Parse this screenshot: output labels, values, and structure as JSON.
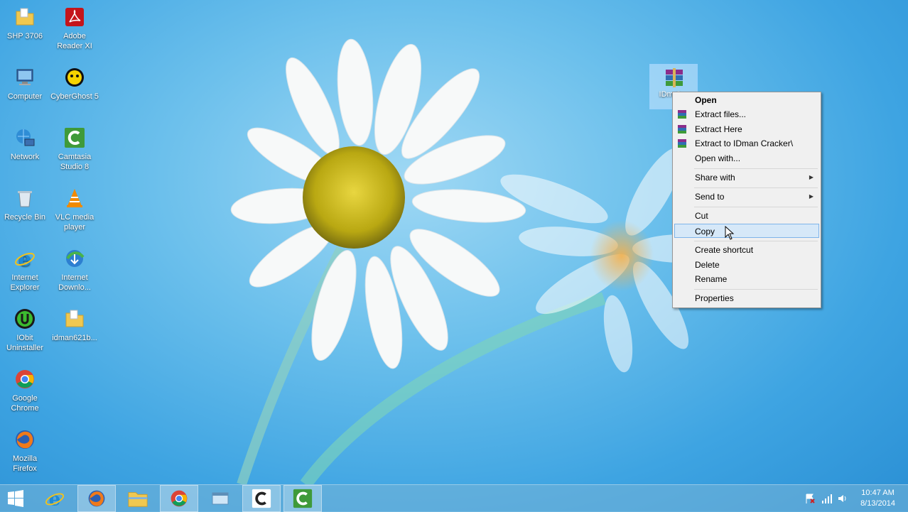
{
  "desktop_icons": [
    {
      "label": "SHP 3706",
      "icon": "folder-icon"
    },
    {
      "label": "Adobe Reader XI",
      "icon": "adobe-reader-icon"
    },
    {
      "label": "Computer",
      "icon": "computer-icon"
    },
    {
      "label": "CyberGhost 5",
      "icon": "cyberghost-icon"
    },
    {
      "label": "Network",
      "icon": "network-icon"
    },
    {
      "label": "Camtasia Studio 8",
      "icon": "camtasia-icon"
    },
    {
      "label": "Recycle Bin",
      "icon": "recycle-bin-icon"
    },
    {
      "label": "VLC media player",
      "icon": "vlc-icon"
    },
    {
      "label": "Internet Explorer",
      "icon": "internet-explorer-icon"
    },
    {
      "label": "Internet Downlo...",
      "icon": "internet-download-manager-icon"
    },
    {
      "label": "IObit Uninstaller",
      "icon": "iobit-icon"
    },
    {
      "label": "idman621b...",
      "icon": "folder-icon"
    },
    {
      "label": "Google Chrome",
      "icon": "chrome-icon"
    },
    {
      "label": "Mozilla Firefox",
      "icon": "firefox-icon"
    }
  ],
  "selected_file": {
    "label": "IDm Cra",
    "icon": "winrar-archive-icon"
  },
  "context_menu": {
    "open": "Open",
    "extract_files": "Extract files...",
    "extract_here": "Extract Here",
    "extract_to": "Extract to IDman Cracker\\",
    "open_with": "Open with...",
    "share_with": "Share with",
    "send_to": "Send to",
    "cut": "Cut",
    "copy": "Copy",
    "create_shortcut": "Create shortcut",
    "delete": "Delete",
    "rename": "Rename",
    "properties": "Properties",
    "highlighted": "Copy"
  },
  "taskbar": {
    "buttons": [
      "start-icon",
      "internet-explorer-icon",
      "firefox-icon",
      "file-explorer-icon",
      "chrome-icon",
      "window-icon",
      "camtasia-icon",
      "camtasia-icon"
    ],
    "clock_time": "10:47 AM",
    "clock_date": "8/13/2014"
  },
  "colors": {
    "highlight": "#d6e8f8",
    "highlight_border": "#7eb4ea",
    "menu_bg": "#f0f0f0"
  }
}
